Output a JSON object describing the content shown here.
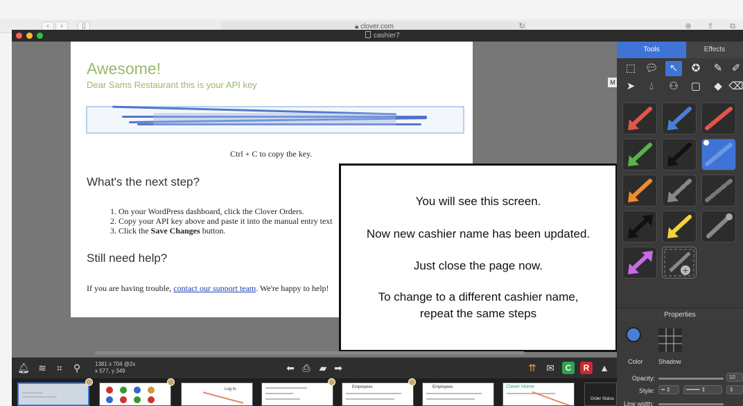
{
  "safari": {
    "url": "clover.com",
    "nav_back": "‹",
    "nav_forward": "›"
  },
  "window": {
    "title": "cashier7"
  },
  "page": {
    "heading": "Awesome!",
    "subheading": "Dear Sams Restaurant this is your API key",
    "copy_hint": "Ctrl + C to copy the key.",
    "next_step_heading": "What's the next step?",
    "steps": [
      "1.  On your WordPress dashboard, click the Clover Orders.",
      "2.  Copy your API key above and paste it into the manual entry text",
      "3.  Click the "
    ],
    "step3_bold": "Save Changes",
    "step3_tail": " button.",
    "help_heading": "Still need help?",
    "trouble_prefix": "If you are having trouble, ",
    "trouble_link": "contact our support team",
    "trouble_suffix": ". We're happy to help!"
  },
  "overlay": {
    "line1": "You will see this screen.",
    "line2": "Now new cashier name has been updated.",
    "line3": "Just close the page now.",
    "line4": "To change to a different cashier name,",
    "line5": "repeat the same steps"
  },
  "canvas_badge": "M",
  "panel": {
    "tab_tools": "Tools",
    "tab_effects": "Effects",
    "properties_title": "Properties",
    "color_label": "Color",
    "shadow_label": "Shadow",
    "opacity_label": "Opacity:",
    "opacity_value": "10",
    "style_label": "Style:",
    "line_width_label": "Line width:"
  },
  "bottom": {
    "dims_line1": "1381 x 704 @2x",
    "dims_line2": "x 577,  y 349",
    "badge_c": "C",
    "badge_r": "R"
  },
  "thumbs": {
    "clover_home": "Clover Home",
    "employees": "Employees",
    "login": "Log In",
    "order_status": "Order Status"
  },
  "colors": {
    "accent_blue": "#3f74d6",
    "page_green": "#9ab86a",
    "badge_c": "#2ea44f",
    "badge_r": "#cc2b2b"
  }
}
